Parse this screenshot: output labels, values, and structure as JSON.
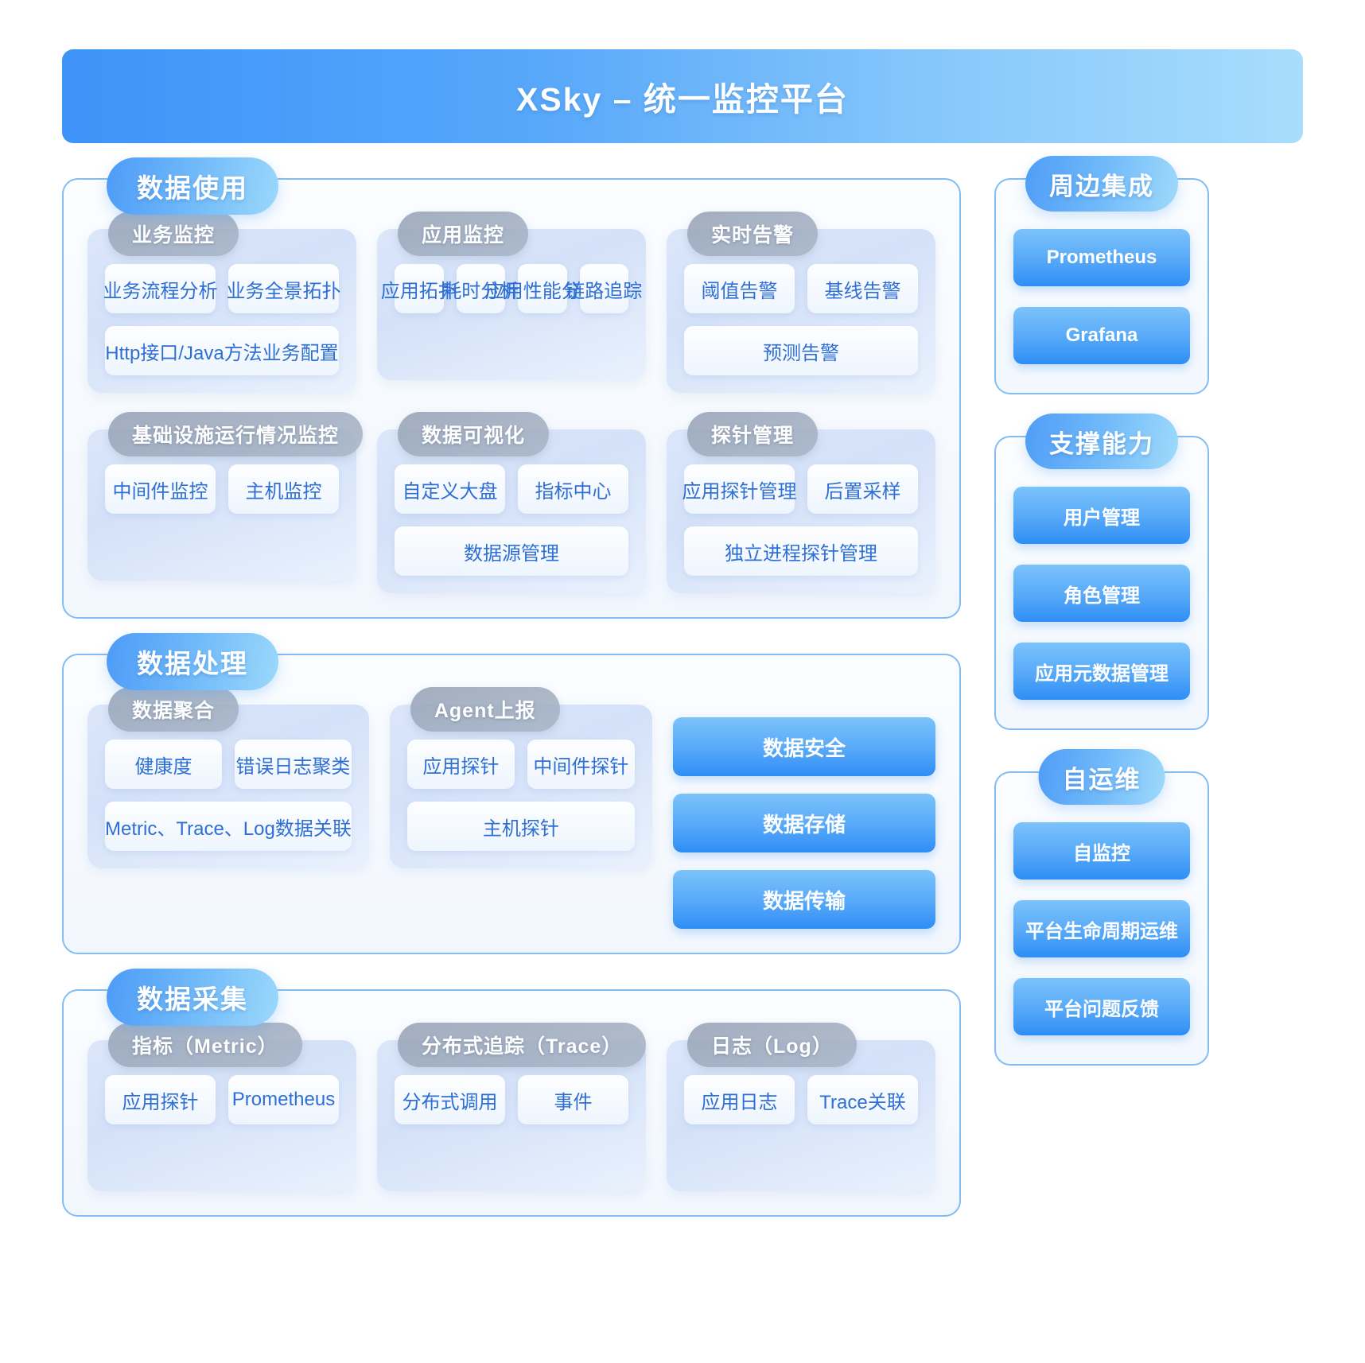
{
  "header": {
    "title": "XSky – 统一监控平台"
  },
  "sections": [
    {
      "label": "数据使用",
      "rows": [
        [
          {
            "title": "业务监控",
            "items": [
              {
                "text": "业务流程分析",
                "full": false
              },
              {
                "text": "业务全景拓扑",
                "full": false
              },
              {
                "text": "Http接口/Java方法业务配置",
                "full": true
              }
            ]
          },
          {
            "title": "应用监控",
            "items": [
              {
                "text": "应用拓扑",
                "full": false
              },
              {
                "text": "耗时分析",
                "full": false
              },
              {
                "text": "应用性能分析",
                "full": false
              },
              {
                "text": "链路追踪",
                "full": false
              }
            ]
          },
          {
            "title": "实时告警",
            "items": [
              {
                "text": "阈值告警",
                "full": false
              },
              {
                "text": "基线告警",
                "full": false
              },
              {
                "text": "预测告警",
                "full": true
              }
            ]
          }
        ],
        [
          {
            "title": "基础设施运行情况监控",
            "items": [
              {
                "text": "中间件监控",
                "full": false
              },
              {
                "text": "主机监控",
                "full": false
              }
            ]
          },
          {
            "title": "数据可视化",
            "items": [
              {
                "text": "自定义大盘",
                "full": false
              },
              {
                "text": "指标中心",
                "full": false
              },
              {
                "text": "数据源管理",
                "full": true
              }
            ]
          },
          {
            "title": "探针管理",
            "items": [
              {
                "text": "应用探针管理",
                "full": false
              },
              {
                "text": "后置采样",
                "full": false
              },
              {
                "text": "独立进程探针管理",
                "full": true
              }
            ]
          }
        ]
      ],
      "buttons": []
    },
    {
      "label": "数据处理",
      "rows": [
        [
          {
            "title": "数据聚合",
            "items": [
              {
                "text": "健康度",
                "full": false
              },
              {
                "text": "错误日志聚类",
                "full": false
              },
              {
                "text": "Metric、Trace、Log数据关联",
                "full": true
              }
            ]
          },
          {
            "title": "Agent上报",
            "items": [
              {
                "text": "应用探针",
                "full": false
              },
              {
                "text": "中间件探针",
                "full": false
              },
              {
                "text": "主机探针",
                "full": true
              }
            ]
          }
        ]
      ],
      "buttons": [
        "数据安全",
        "数据存储",
        "数据传输"
      ]
    },
    {
      "label": "数据采集",
      "rows": [
        [
          {
            "title": "指标（Metric）",
            "items": [
              {
                "text": "应用探针",
                "full": false
              },
              {
                "text": "Prometheus",
                "full": false
              }
            ]
          },
          {
            "title": "分布式追踪（Trace）",
            "items": [
              {
                "text": "分布式调用",
                "full": false
              },
              {
                "text": "事件",
                "full": false
              }
            ]
          },
          {
            "title": "日志（Log）",
            "items": [
              {
                "text": "应用日志",
                "full": false
              },
              {
                "text": "Trace关联",
                "full": false
              }
            ]
          }
        ]
      ],
      "buttons": []
    }
  ],
  "rails": [
    {
      "label": "周边集成",
      "items": [
        "Prometheus",
        "Grafana"
      ]
    },
    {
      "label": "支撑能力",
      "items": [
        "用户管理",
        "角色管理",
        "应用元数据管理"
      ]
    },
    {
      "label": "自运维",
      "items": [
        "自监控",
        "平台生命周期运维",
        "平台问题反馈"
      ]
    }
  ],
  "colors": {
    "accent": "#3d93f8",
    "panel_border": "#82bdf3",
    "chip_text": "#2d6fd4",
    "group_pill": "#a0aec4"
  }
}
